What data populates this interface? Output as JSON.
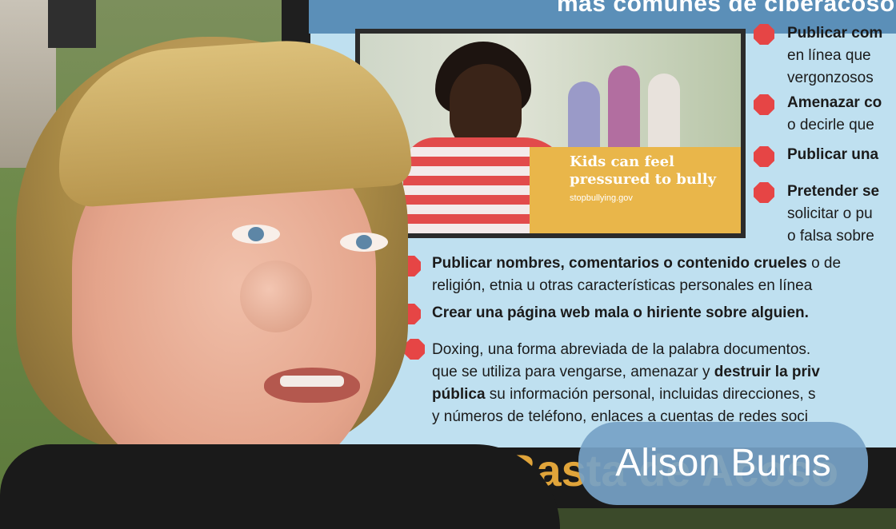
{
  "poster": {
    "header": "más comunes de ciberacoso",
    "photo_caption": "Kids can feel pressured to bully",
    "photo_logo": "stopbullying.gov",
    "right_items": [
      [
        "Publicar com",
        "en línea que",
        "vergonzosos"
      ],
      [
        "Amenazar co",
        "o decirle que"
      ],
      [
        "Publicar una"
      ],
      [
        "Pretender se",
        "solicitar o pu",
        "o falsa sobre"
      ]
    ],
    "lower_items": [
      {
        "bold": "Publicar nombres, comentarios o contenido crueles",
        "rest": " o de",
        "line2": "religión, etnia u otras características personales en línea"
      },
      {
        "bold": "Crear una página web mala o hiriente sobre alguien."
      },
      {
        "line1": "Doxing, una forma abreviada de la palabra documentos.",
        "line2_a": "que se utiliza para vengarse, amenazar y ",
        "line2_b": "destruir la priv",
        "line3_b": "pública",
        "line3_a": " su información personal, incluidas direcciones, s",
        "line4": "y números de teléfono, enlaces a cuentas de redes soci"
      }
    ],
    "bottom_text": "Basta de Acoso"
  },
  "caption": {
    "name": "Alison Burns"
  },
  "colors": {
    "poster_bg": "#bfe0f0",
    "bullet": "#e64545",
    "caption_pill": "#76a2c7"
  }
}
